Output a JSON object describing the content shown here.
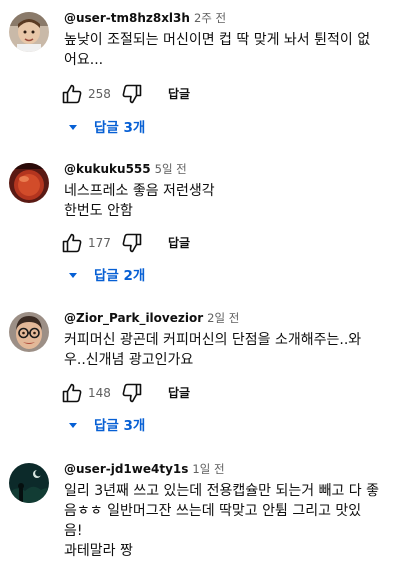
{
  "comments": [
    {
      "author": "@user-tm8hz8xl3h",
      "time": "2주 전",
      "lines": [
        "높낮이 조절되는 머신이면 컵 딱 맞게 놔서 튄적이 없",
        "어요..."
      ],
      "likes": "258",
      "reply_label": "답글",
      "replies_label": "답글 3개",
      "avatar_icon": "child-photo-avatar"
    },
    {
      "author": "@kukuku555",
      "time": "5일 전",
      "lines": [
        "네스프레소 좋음 저런생각",
        "한번도 안함"
      ],
      "likes": "177",
      "reply_label": "답글",
      "replies_label": "답글 2개",
      "avatar_icon": "red-drink-avatar"
    },
    {
      "author": "@Zior_Park_ilovezior",
      "time": "2일 전",
      "lines": [
        "커피머신 광곤데 커피머신의 단점을 소개해주는..와",
        "우..신개념 광고인가요"
      ],
      "likes": "148",
      "reply_label": "답글",
      "replies_label": "답글 3개",
      "avatar_icon": "glasses-person-avatar"
    },
    {
      "author": "@user-jd1we4ty1s",
      "time": "1일 전",
      "lines": [
        "일리 3년째 쓰고 있는데 전용캡슐만 되는거 빼고 다 좋",
        "음ㅎㅎ 일반머그잔 쓰는데 딱맞고 안튐 그리고 맛있",
        "음!",
        "과테말라 짱"
      ],
      "avatar_icon": "night-scene-avatar"
    }
  ],
  "colors": {
    "link": "#065fd4",
    "secondary_text": "#606060",
    "primary_text": "#0f0f0f"
  }
}
